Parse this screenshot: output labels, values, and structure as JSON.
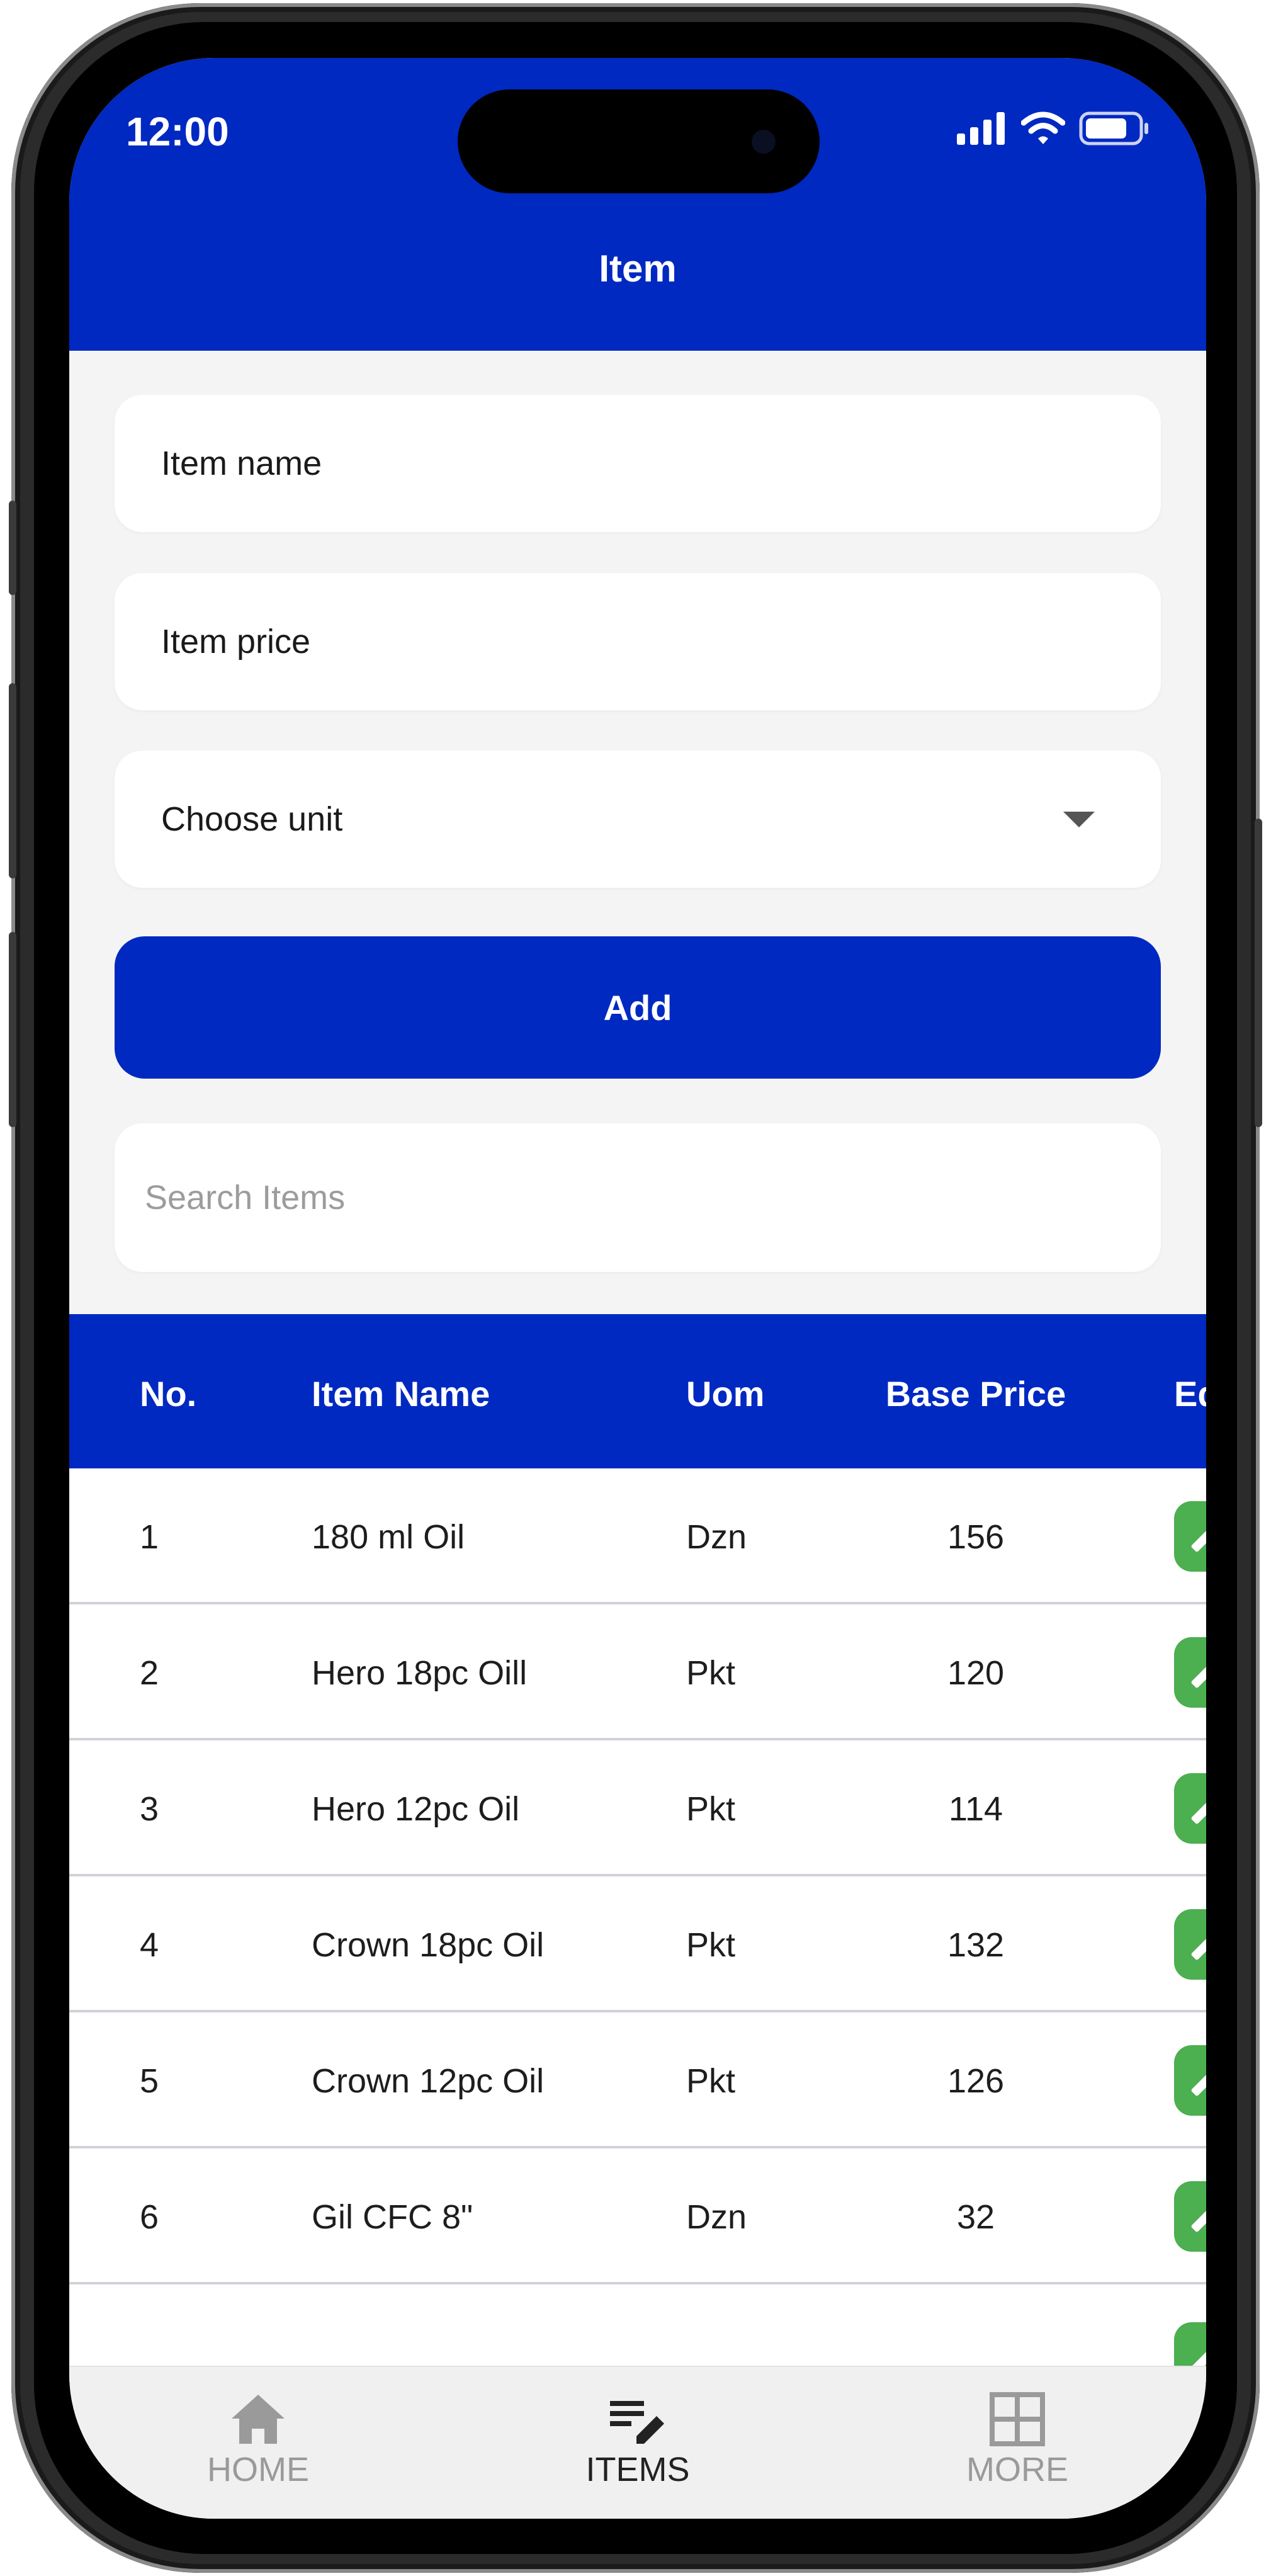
{
  "status_bar": {
    "time": "12:00"
  },
  "header": {
    "title": "Item"
  },
  "form": {
    "item_name_placeholder": "Item name",
    "item_price_placeholder": "Item price",
    "unit_select_value": "Choose unit",
    "add_label": "Add",
    "search_placeholder": "Search Items"
  },
  "table": {
    "headers": {
      "no": "No.",
      "name": "Item Name",
      "uom": "Uom",
      "price": "Base Price",
      "edit": "Edit"
    },
    "rows": [
      {
        "no": "1",
        "name": "180 ml Oil",
        "uom": "Dzn",
        "price": "156"
      },
      {
        "no": "2",
        "name": "Hero 18pc Oill",
        "uom": "Pkt",
        "price": "120"
      },
      {
        "no": "3",
        "name": "Hero 12pc Oil",
        "uom": "Pkt",
        "price": "114"
      },
      {
        "no": "4",
        "name": "Crown 18pc Oil",
        "uom": "Pkt",
        "price": "132"
      },
      {
        "no": "5",
        "name": "Crown 12pc Oil",
        "uom": "Pkt",
        "price": "126"
      },
      {
        "no": "6",
        "name": "Gil CFC 8\"",
        "uom": "Dzn",
        "price": "32"
      }
    ]
  },
  "bottom_nav": {
    "items": [
      {
        "label": "HOME",
        "icon": "home-icon",
        "active": false
      },
      {
        "label": "ITEMS",
        "icon": "edit-list-icon",
        "active": true
      },
      {
        "label": "MORE",
        "icon": "grid-icon",
        "active": false
      }
    ]
  },
  "colors": {
    "primary": "#0029c1",
    "edit_button": "#4caf50",
    "background": "#f4f4f4"
  }
}
